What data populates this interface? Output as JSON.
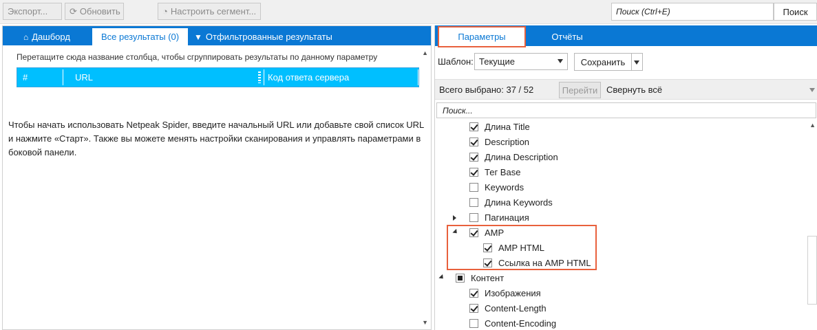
{
  "toolbar": {
    "export_label": "Экспорт...",
    "refresh_label": "Обновить",
    "segment_label": "Настроить сегмент...",
    "search_placeholder": "Поиск (Ctrl+E)",
    "search_button": "Поиск"
  },
  "left_panel": {
    "tabs": [
      {
        "label": "Дашборд",
        "icon": "home-icon"
      },
      {
        "label": "Все результаты (0)",
        "active": true
      },
      {
        "label": "Отфильтрованные результаты",
        "icon": "filter-icon"
      }
    ],
    "group_hint": "Перетащите сюда название столбца, чтобы сгруппировать результаты по данному параметру",
    "columns": [
      "#",
      "URL",
      "Код ответа сервера"
    ],
    "intro_text": "Чтобы начать использовать Netpeak Spider, введите начальный URL или добавьте свой список URL и нажмите «Старт». Также вы можете менять настройки сканирования и управлять параметрами в боковой панели."
  },
  "right_panel": {
    "tabs": [
      {
        "label": "Параметры",
        "active": true
      },
      {
        "label": "Отчёты"
      }
    ],
    "template_label": "Шаблон:",
    "template_value": "Текущие",
    "save_label": "Сохранить",
    "selected_text": "Всего выбрано: 37 / 52",
    "goto_label": "Перейти",
    "collapse_label": "Свернуть всё",
    "param_search_placeholder": "Поиск...",
    "tree": [
      {
        "label": "Длина Title",
        "state": "checked",
        "level": 1
      },
      {
        "label": "Description",
        "state": "checked",
        "level": 1
      },
      {
        "label": "Длина Description",
        "state": "checked",
        "level": 1
      },
      {
        "label": "Тег Base",
        "state": "checked",
        "level": 1
      },
      {
        "label": "Keywords",
        "state": "unchecked",
        "level": 1
      },
      {
        "label": "Длина Keywords",
        "state": "unchecked",
        "level": 1
      },
      {
        "label": "Пагинация",
        "state": "unchecked",
        "level": 1,
        "expander": "collapsed"
      },
      {
        "label": "AMP",
        "state": "checked",
        "level": 1,
        "expander": "expanded"
      },
      {
        "label": "AMP HTML",
        "state": "checked",
        "level": 2
      },
      {
        "label": "Ссылка на AMP HTML",
        "state": "checked",
        "level": 2
      },
      {
        "label": "Контент",
        "state": "partial",
        "level": 0,
        "expander": "expanded"
      },
      {
        "label": "Изображения",
        "state": "checked",
        "level": 1
      },
      {
        "label": "Content-Length",
        "state": "checked",
        "level": 1
      },
      {
        "label": "Content-Encoding",
        "state": "unchecked",
        "level": 1
      }
    ]
  },
  "colors": {
    "accent": "#0a78d4",
    "header_row": "#00bfff",
    "highlight": "#e8603c"
  }
}
